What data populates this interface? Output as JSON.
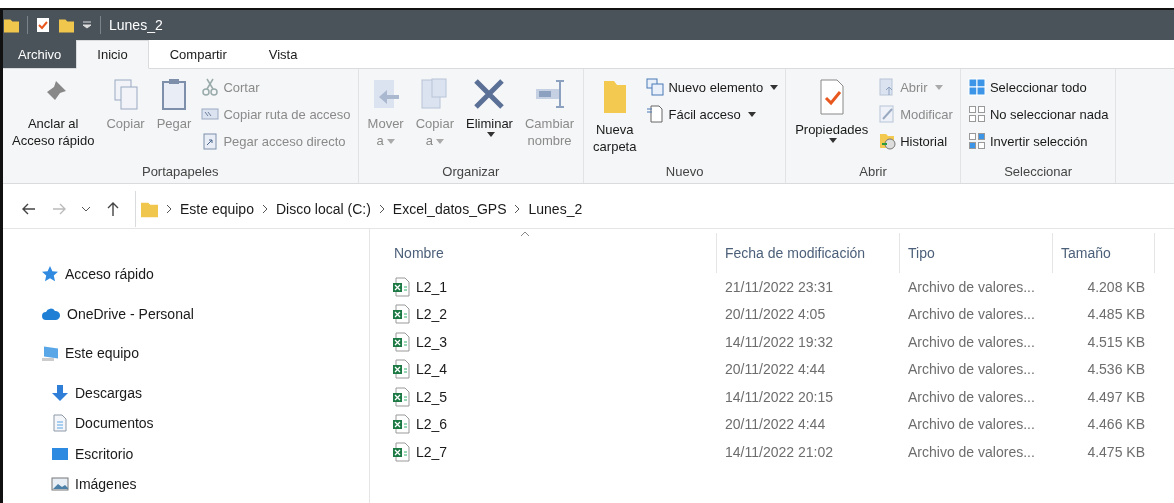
{
  "window": {
    "title": "Lunes_2"
  },
  "tabs": [
    {
      "label": "Archivo",
      "kind": "file",
      "selected": false
    },
    {
      "label": "Inicio",
      "kind": "tab",
      "selected": true
    },
    {
      "label": "Compartir",
      "kind": "tab",
      "selected": false
    },
    {
      "label": "Vista",
      "kind": "tab",
      "selected": false
    }
  ],
  "ribbon": {
    "groups": [
      {
        "label": "Portapapeles",
        "items": [
          {
            "kind": "large",
            "label": "Anclar al\nAcceso rápido",
            "disabled": false
          },
          {
            "kind": "large",
            "label": "Copiar",
            "disabled": true
          },
          {
            "kind": "large",
            "label": "Pegar",
            "disabled": true
          },
          {
            "kind": "small",
            "label": "Cortar",
            "disabled": true
          },
          {
            "kind": "small",
            "label": "Copiar ruta de acceso",
            "disabled": true
          },
          {
            "kind": "small",
            "label": "Pegar acceso directo",
            "disabled": true
          }
        ]
      },
      {
        "label": "Organizar",
        "items": [
          {
            "kind": "large",
            "label": "Mover\na",
            "disabled": true,
            "dropdown": true
          },
          {
            "kind": "large",
            "label": "Copiar\na",
            "disabled": true,
            "dropdown": true
          },
          {
            "kind": "large",
            "label": "Eliminar",
            "disabled": false,
            "split_dropdown": true
          },
          {
            "kind": "large",
            "label": "Cambiar\nnombre",
            "disabled": true
          }
        ]
      },
      {
        "label": "Nuevo",
        "items": [
          {
            "kind": "large",
            "label": "Nueva\ncarpeta",
            "disabled": false
          },
          {
            "kind": "small",
            "label": "Nuevo elemento",
            "disabled": false,
            "dropdown": true
          },
          {
            "kind": "small",
            "label": "Fácil acceso",
            "disabled": false,
            "dropdown": true
          }
        ]
      },
      {
        "label": "Abrir",
        "items": [
          {
            "kind": "large",
            "label": "Propiedades",
            "disabled": false,
            "split_dropdown": true
          },
          {
            "kind": "small",
            "label": "Abrir",
            "disabled": true,
            "dropdown": true
          },
          {
            "kind": "small",
            "label": "Modificar",
            "disabled": true
          },
          {
            "kind": "small",
            "label": "Historial",
            "disabled": false
          }
        ]
      },
      {
        "label": "Seleccionar",
        "items": [
          {
            "kind": "small",
            "label": "Seleccionar todo",
            "disabled": false
          },
          {
            "kind": "small",
            "label": "No seleccionar nada",
            "disabled": false
          },
          {
            "kind": "small",
            "label": "Invertir selección",
            "disabled": false
          }
        ]
      }
    ]
  },
  "address_bar": {
    "back_disabled": false,
    "forward_disabled": true,
    "path": [
      "Este equipo",
      "Disco local (C:)",
      "Excel_datos_GPS",
      "Lunes_2"
    ]
  },
  "sidebar": {
    "items": [
      {
        "label": "Acceso rápido"
      },
      {
        "label": "OneDrive - Personal"
      },
      {
        "label": "Este equipo",
        "children": [
          {
            "label": "Descargas"
          },
          {
            "label": "Documentos"
          },
          {
            "label": "Escritorio"
          },
          {
            "label": "Imágenes"
          }
        ]
      }
    ]
  },
  "table": {
    "columns": [
      "Nombre",
      "Fecha de modificación",
      "Tipo",
      "Tamaño"
    ],
    "rows": [
      {
        "name": "L2_1",
        "modified": "21/11/2022 23:31",
        "type": "Archivo de valores...",
        "size": "4.208 KB"
      },
      {
        "name": "L2_2",
        "modified": "20/11/2022 4:05",
        "type": "Archivo de valores...",
        "size": "4.485 KB"
      },
      {
        "name": "L2_3",
        "modified": "14/11/2022 19:32",
        "type": "Archivo de valores...",
        "size": "4.515 KB"
      },
      {
        "name": "L2_4",
        "modified": "20/11/2022 4:44",
        "type": "Archivo de valores...",
        "size": "4.536 KB"
      },
      {
        "name": "L2_5",
        "modified": "14/11/2022 20:15",
        "type": "Archivo de valores...",
        "size": "4.497 KB"
      },
      {
        "name": "L2_6",
        "modified": "20/11/2022 4:44",
        "type": "Archivo de valores...",
        "size": "4.466 KB"
      },
      {
        "name": "L2_7",
        "modified": "14/11/2022 21:02",
        "type": "Archivo de valores...",
        "size": "4.475 KB"
      }
    ]
  }
}
